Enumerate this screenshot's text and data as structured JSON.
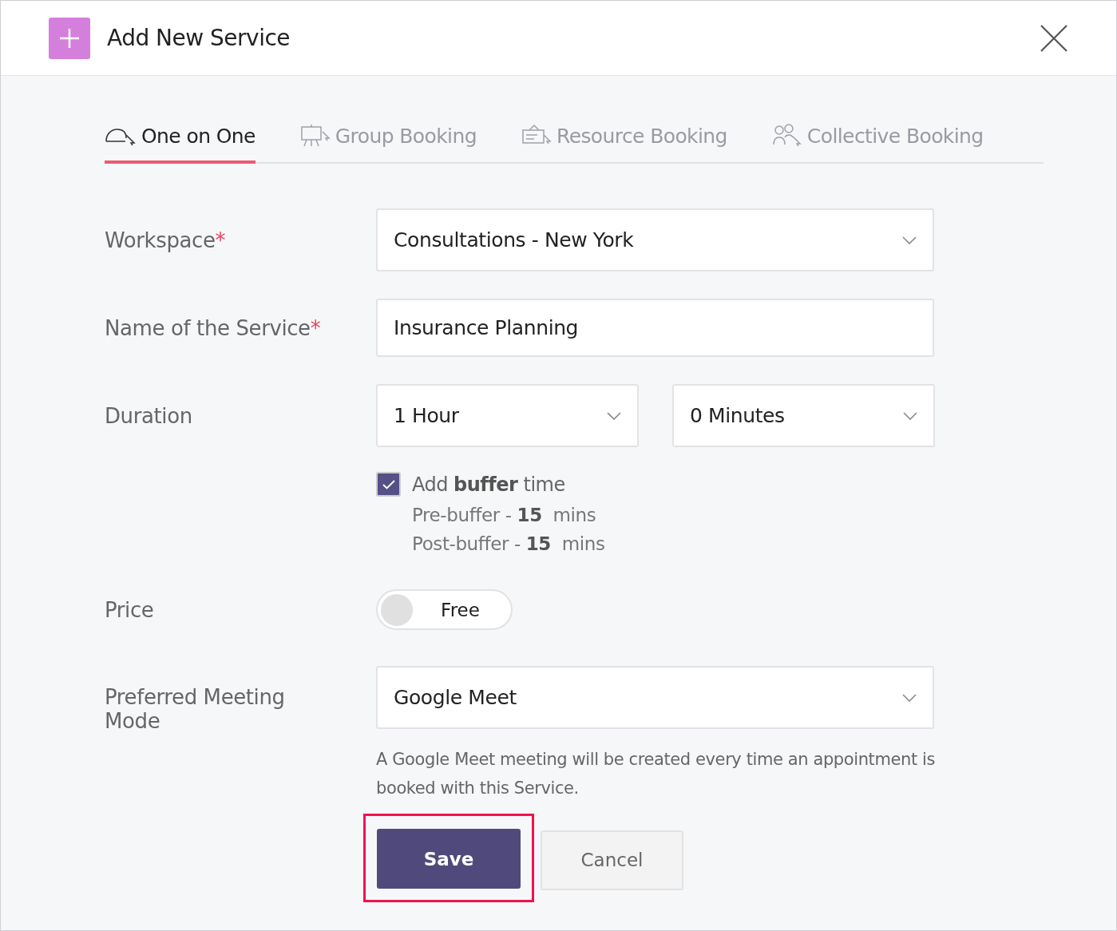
{
  "dialog": {
    "title": "Add New Service"
  },
  "tabs": [
    {
      "label": "One on One",
      "selected": true,
      "kind": "one"
    },
    {
      "label": "Group Booking",
      "selected": false,
      "kind": "group"
    },
    {
      "label": "Resource Booking",
      "selected": false,
      "kind": "resource"
    },
    {
      "label": "Collective Booking",
      "selected": false,
      "kind": "collective"
    }
  ],
  "workspace": {
    "label": "Workspace",
    "required_mark": "*",
    "value": "Consultations - New York"
  },
  "service_name": {
    "label": "Name of the Service",
    "required_mark": "*",
    "value": "Insurance Planning"
  },
  "duration": {
    "label": "Duration",
    "hours": "1 Hour",
    "minutes": "0 Minutes"
  },
  "buffer": {
    "label": "Add **buffer** time",
    "checked": true,
    "lines": [
      "Pre-buffer - **15**  mins",
      "Post-buffer - **15**  mins"
    ]
  },
  "price": {
    "label": "Price",
    "on": false,
    "value": "Free"
  },
  "meeting_mode": {
    "label": "Preferred Meeting Mode",
    "value": "Google Meet",
    "note": "A Google Meet meeting will be created every time an appointment is booked with this Service."
  },
  "buttons": {
    "save": "Save",
    "cancel": "Cancel",
    "save_highlighted": true
  }
}
